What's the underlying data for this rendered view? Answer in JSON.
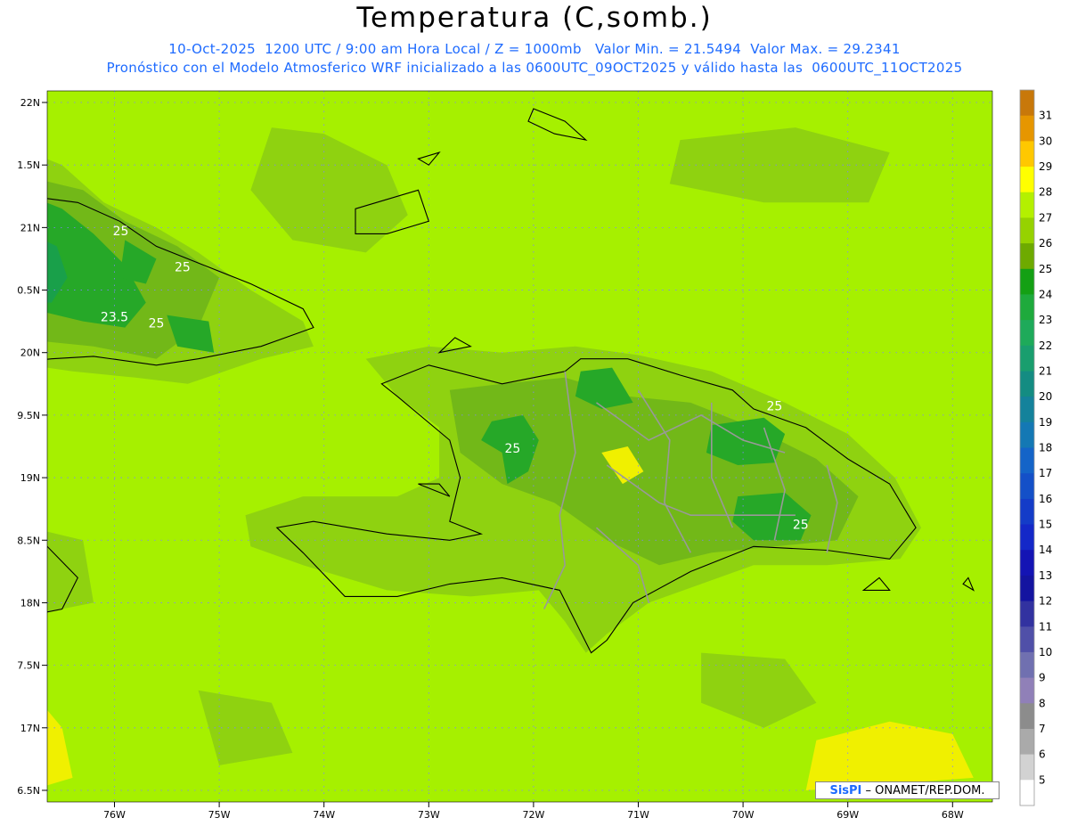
{
  "header": {
    "title": "Temperatura (C,somb.)",
    "subtitle_1": "10-Oct-2025  1200 UTC / 9:00 am Hora Local / Z = 1000mb   Valor Min. = 21.5494  Valor Max. = 29.2341",
    "subtitle_2": "Pronóstico con el Modelo Atmosferico WRF inicializado a las 0600UTC_09OCT2025 y válido hasta las  0600UTC_11OCT2025"
  },
  "map": {
    "lat_ticks": [
      "22N",
      "1.5N",
      "21N",
      "0.5N",
      "20N",
      "9.5N",
      "19N",
      "8.5N",
      "18N",
      "7.5N",
      "17N",
      "6.5N"
    ],
    "lon_ticks": [
      "76W",
      "75W",
      "74W",
      "73W",
      "72W",
      "71W",
      "70W",
      "69W",
      "68W"
    ],
    "contour_labels": [
      {
        "text": "25",
        "lon": -75.94,
        "lat": 20.94
      },
      {
        "text": "25",
        "lon": -75.35,
        "lat": 20.65
      },
      {
        "text": "23.5",
        "lon": -76.0,
        "lat": 20.25
      },
      {
        "text": "25",
        "lon": -75.6,
        "lat": 20.2
      },
      {
        "text": "25",
        "lon": -72.2,
        "lat": 19.2
      },
      {
        "text": "25",
        "lon": -69.7,
        "lat": 19.54
      },
      {
        "text": "25",
        "lon": -69.45,
        "lat": 18.59
      }
    ],
    "colors": {
      "background": "#a6f000",
      "level_27": "#a6f000",
      "level_26": "#8fd210",
      "level_25": "#72b818",
      "level_24": "#26a828",
      "level_23": "#19a04a",
      "level_28": "#f0f000",
      "coast": "#000000",
      "provinces": "#999999",
      "grid": "#8080ff"
    }
  },
  "colorbar": {
    "levels": [
      "31",
      "30",
      "29",
      "28",
      "27",
      "26",
      "25",
      "24",
      "23",
      "22",
      "21",
      "20",
      "19",
      "18",
      "17",
      "16",
      "15",
      "14",
      "13",
      "12",
      "11",
      "10",
      "9",
      "8",
      "7",
      "6",
      "5"
    ],
    "colors": [
      "#c8780a",
      "#e69600",
      "#ffc800",
      "#ffff00",
      "#b4f000",
      "#96d200",
      "#6eaa00",
      "#14a014",
      "#1eaa3c",
      "#1eaa5a",
      "#199e6e",
      "#148c82",
      "#14829b",
      "#1478b4",
      "#1464c8",
      "#1450c8",
      "#143cc8",
      "#1428c8",
      "#1414b4",
      "#1414a0",
      "#3232a0",
      "#5050a8",
      "#7070b0",
      "#9080b8",
      "#8c8c8c",
      "#aaaaaa",
      "#d2d2d2",
      "#ffffff"
    ]
  },
  "credit": {
    "logo": "SisPI",
    "text": " –  ONAMET/REP.DOM."
  }
}
